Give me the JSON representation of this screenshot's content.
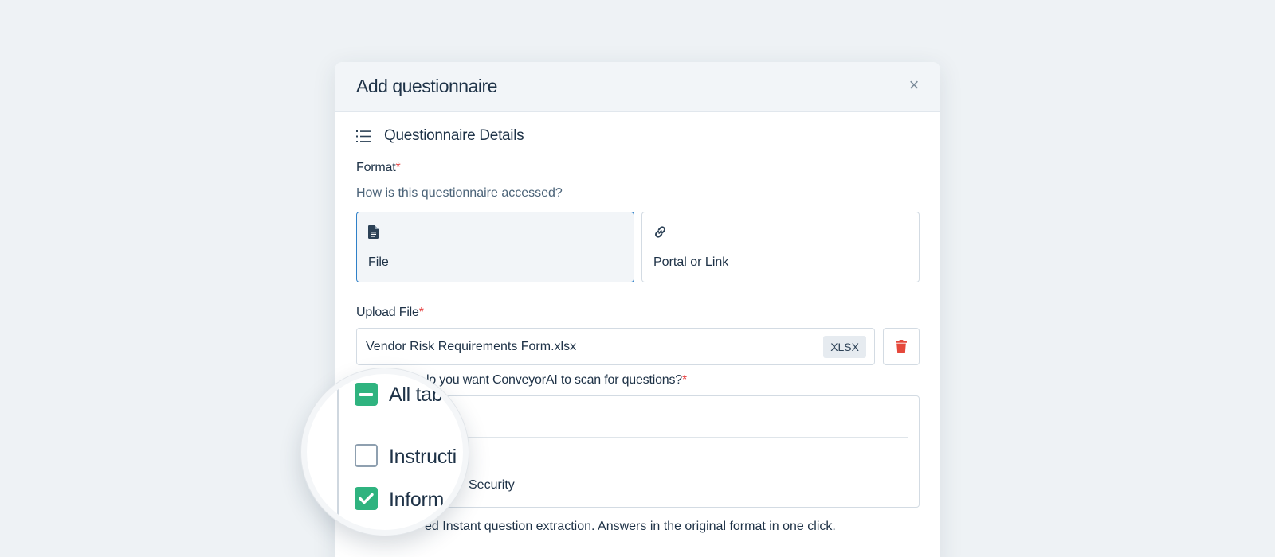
{
  "modal": {
    "title": "Add questionnaire",
    "close_icon": "close-icon"
  },
  "section": {
    "icon": "list-icon",
    "title": "Questionnaire Details"
  },
  "format": {
    "label": "Format",
    "required_mark": "*",
    "help": "How is this questionnaire accessed?",
    "options": [
      {
        "icon": "document-icon",
        "label": "File",
        "selected": true
      },
      {
        "icon": "link-icon",
        "label": "Portal or Link",
        "selected": false
      }
    ]
  },
  "upload": {
    "label": "Upload File",
    "required_mark": "*",
    "file_name": "Vendor Risk Requirements Form.xlsx",
    "file_type": "XLSX",
    "delete_icon": "trash-icon"
  },
  "scan": {
    "label": "lo you want ConveyorAI to scan for questions?",
    "required_mark": "*",
    "visible_item_suffix": "Security"
  },
  "magnifier": {
    "items": [
      {
        "label": "All tab",
        "state": "indeterminate"
      },
      {
        "label": "Instructi",
        "state": "unchecked"
      },
      {
        "label": "Inform",
        "state": "checked"
      }
    ]
  },
  "footer_note": "ed Instant question extraction. Answers in the original format in one click.",
  "colors": {
    "accent_blue": "#2f80c8",
    "check_green": "#2fb37f",
    "required_red": "#e53e3e",
    "delete_red": "#e5483b"
  }
}
